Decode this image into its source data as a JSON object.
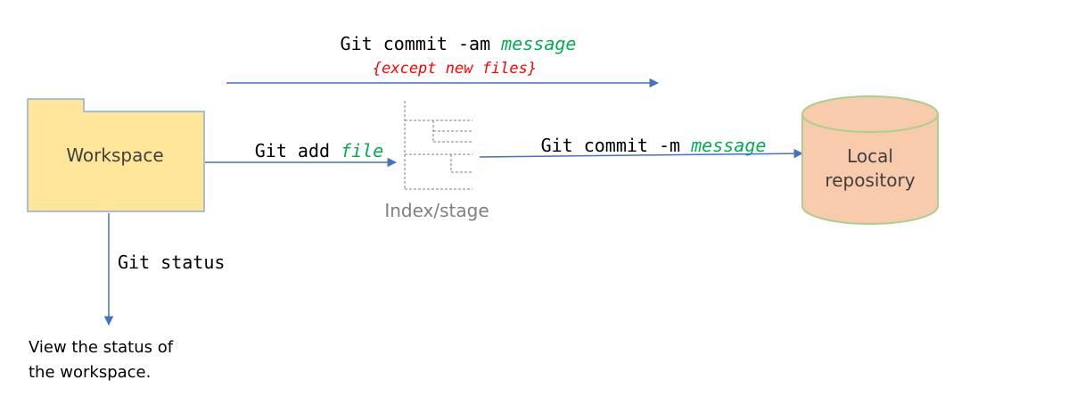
{
  "commit_all": {
    "command": "Git commit -am ",
    "argument": "message",
    "note": "{except new files}"
  },
  "workspace": {
    "label": "Workspace"
  },
  "add": {
    "command": "Git add ",
    "argument": "file"
  },
  "index": {
    "label": "Index/stage"
  },
  "commit": {
    "command": "Git commit -m ",
    "argument": "message"
  },
  "repository": {
    "label_line1": "Local",
    "label_line2": "repository"
  },
  "status": {
    "command": "Git status",
    "description_line1": "View the status of",
    "description_line2": "the workspace."
  },
  "colors": {
    "arrow": "#4472c4",
    "argument": "#00b050",
    "note": "#ff0000",
    "folder_fill": "#ffe699",
    "folder_stroke": "#8faadc",
    "cylinder_fill": "#f8cbad",
    "cylinder_stroke": "#a9d18e",
    "index_stroke": "#808080"
  }
}
